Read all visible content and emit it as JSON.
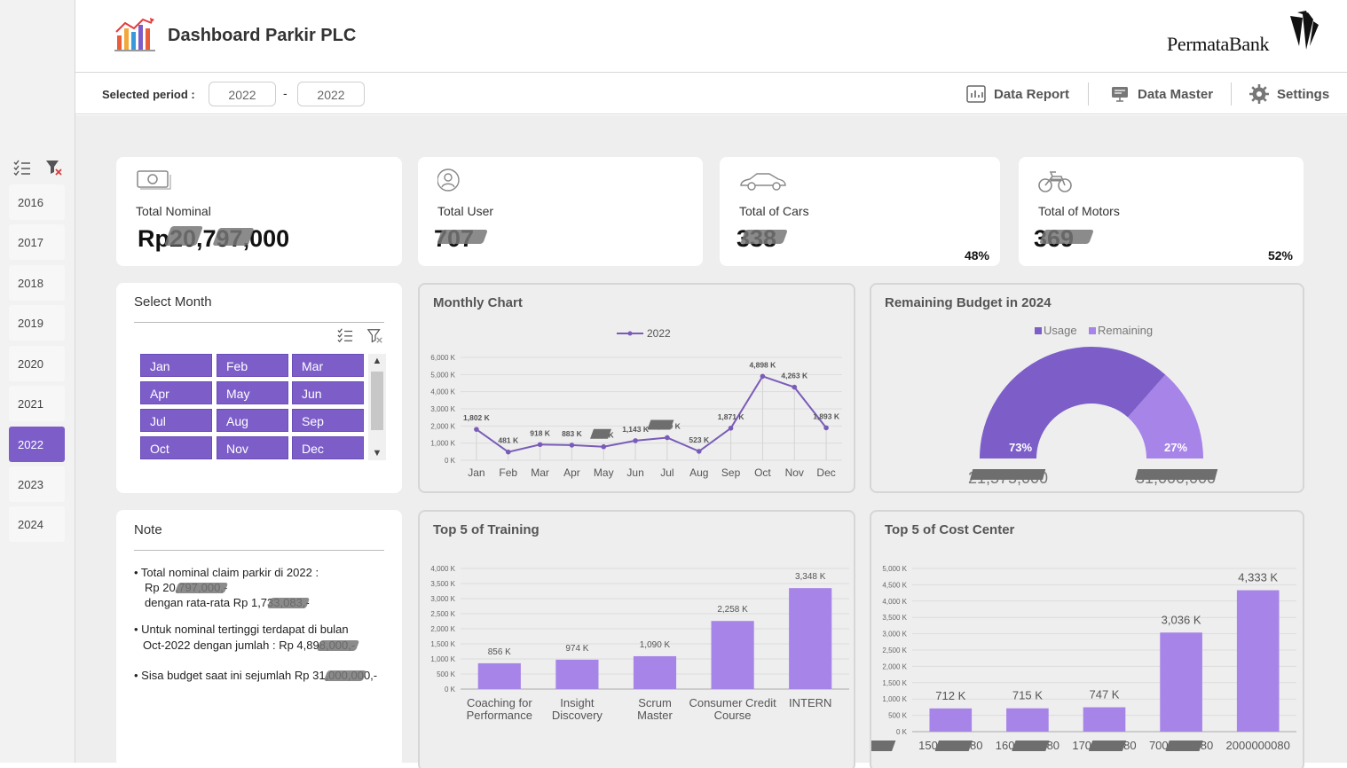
{
  "app": {
    "title": "Dashboard Parkir PLC",
    "bank_name": "PermataBank"
  },
  "period": {
    "label": "Selected period :",
    "from": "2022",
    "to": "2022",
    "separator": "-"
  },
  "nav": {
    "data_report": "Data Report",
    "data_master": "Data Master",
    "settings": "Settings"
  },
  "sidebar": {
    "years": [
      "2016",
      "2017",
      "2018",
      "2019",
      "2020",
      "2021",
      "2022",
      "2023",
      "2024"
    ],
    "selected": "2022"
  },
  "kpis": {
    "total_nominal": {
      "label": "Total Nominal",
      "value": "Rp20,797,000"
    },
    "total_user": {
      "label": "Total User",
      "value": "707"
    },
    "total_cars": {
      "label": "Total of Cars",
      "value": "338",
      "pct": "48%"
    },
    "total_motors": {
      "label": "Total of Motors",
      "value": "369",
      "pct": "52%"
    }
  },
  "month_slicer": {
    "title": "Select Month",
    "months": [
      "Jan",
      "Feb",
      "Mar",
      "Apr",
      "May",
      "Jun",
      "Jul",
      "Aug",
      "Sep",
      "Oct",
      "Nov",
      "Dec"
    ]
  },
  "note": {
    "title": "Note",
    "lines": [
      "• Total nominal claim parkir di 2022 :",
      "Rp 20,797,000,-",
      "dengan rata-rata Rp 1,733,083,-",
      "• Untuk nominal tertinggi terdapat di bulan",
      "Oct-2022 dengan jumlah : Rp 4,898,000,-",
      "• Sisa budget saat ini sejumlah Rp 31,000,000,-"
    ]
  },
  "colors": {
    "accent": "#7d5ec9",
    "accent_light": "#a784e8",
    "line": "#7a5cb8",
    "bar": "#a784e8"
  },
  "charts": {
    "monthly": {
      "title": "Monthly Chart",
      "legend": "2022"
    },
    "budget": {
      "title": "Remaining Budget in 2024",
      "legend_usage": "Usage",
      "legend_remaining": "Remaining",
      "usage_pct": "73%",
      "remaining_pct": "27%",
      "usage_value": "21,575,000",
      "remaining_value": "31,000,000"
    },
    "training": {
      "title": "Top 5 of Training"
    },
    "cost_center": {
      "title": "Top 5 of Cost Center"
    }
  },
  "chart_data": [
    {
      "type": "line",
      "title": "Monthly Chart",
      "categories": [
        "Jan",
        "Feb",
        "Mar",
        "Apr",
        "May",
        "Jun",
        "Jul",
        "Aug",
        "Sep",
        "Oct",
        "Nov",
        "Dec"
      ],
      "series": [
        {
          "name": "2022",
          "values": [
            1802,
            481,
            918,
            883,
            790,
            1143,
            1320,
            523,
            1871,
            4898,
            4263,
            1893
          ]
        }
      ],
      "data_labels": [
        "1,802 K",
        "481 K",
        "918 K",
        "883 K",
        "790 K",
        "1,143 K",
        "1,320 K",
        "523 K",
        "1,871 K",
        "4,898 K",
        "4,263 K",
        "1,893 K"
      ],
      "yticks": [
        "0 K",
        "1,000 K",
        "2,000 K",
        "3,000 K",
        "4,000 K",
        "5,000 K",
        "6,000 K"
      ],
      "ylim": [
        0,
        6000
      ],
      "grid": true,
      "legend": "top-center"
    },
    {
      "type": "pie",
      "title": "Remaining Budget in 2024",
      "categories": [
        "Usage",
        "Remaining"
      ],
      "values": [
        73,
        27
      ],
      "legend": "top-center"
    },
    {
      "type": "bar",
      "title": "Top 5 of Training",
      "categories": [
        "Coaching for Performance",
        "Insight Discovery",
        "Scrum Master",
        "Consumer Credit Course",
        "INTERN"
      ],
      "values": [
        856,
        974,
        1090,
        2258,
        3348
      ],
      "data_labels": [
        "856 K",
        "974 K",
        "1,090 K",
        "2,258 K",
        "3,348 K"
      ],
      "yticks": [
        "0 K",
        "500 K",
        "1,000 K",
        "1,500 K",
        "2,000 K",
        "2,500 K",
        "3,000 K",
        "3,500 K",
        "4,000 K"
      ],
      "ylim": [
        0,
        4000
      ]
    },
    {
      "type": "bar",
      "title": "Top 5 of Cost Center",
      "categories": [
        "1500000080",
        "1600000080",
        "1700000080",
        "7000000080",
        "2000000080"
      ],
      "values": [
        712,
        715,
        747,
        3036,
        4333
      ],
      "data_labels": [
        "712 K",
        "715 K",
        "747 K",
        "3,036 K",
        "4,333 K"
      ],
      "yticks": [
        "0 K",
        "500 K",
        "1,000 K",
        "1,500 K",
        "2,000 K",
        "2,500 K",
        "3,000 K",
        "3,500 K",
        "4,000 K",
        "4,500 K",
        "5,000 K"
      ],
      "ylim": [
        0,
        5000
      ]
    }
  ]
}
